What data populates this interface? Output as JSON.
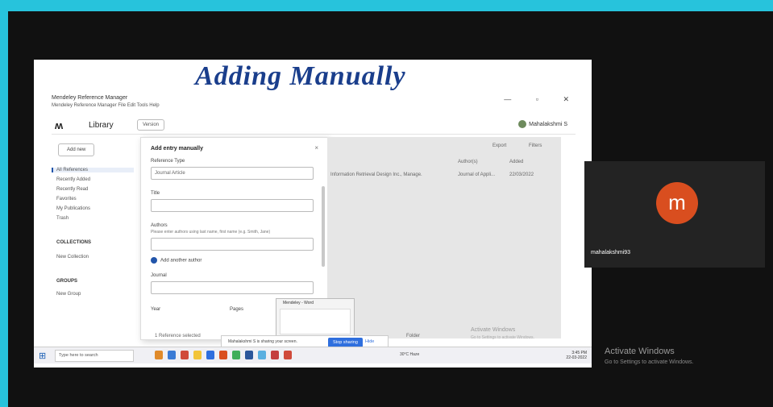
{
  "slide": {
    "title": "Adding Manually"
  },
  "window": {
    "title": "Mendeley Reference Manager",
    "menu": "Mendeley Reference Manager  File  Edit  Tools  Help",
    "controls": "— ▫ ✕"
  },
  "toolbar": {
    "logo": "ʍ",
    "library": "Library",
    "version": "Version",
    "account": "Mahalakshmi S"
  },
  "sidebar": {
    "add_new": "Add new",
    "items": [
      {
        "label": "All References"
      },
      {
        "label": "Recently Added"
      },
      {
        "label": "Recently Read"
      },
      {
        "label": "Favorites"
      },
      {
        "label": "My Publications"
      },
      {
        "label": "Trash"
      }
    ],
    "collections": "COLLECTIONS",
    "new_collection": "New Collection",
    "groups": "GROUPS",
    "new_group": "New Group"
  },
  "dialog": {
    "title": "Add entry manually",
    "close": "×",
    "reference_type_label": "Reference Type",
    "reference_type_value": "Journal Article",
    "title_label": "Title",
    "authors_label": "Authors",
    "authors_hint": "Please enter authors using last name, first name (e.g. Smith, Jane)",
    "add_author": "Add another author",
    "journal_label": "Journal",
    "year_label": "Year",
    "pages_label": "Pages"
  },
  "library": {
    "export": "Export",
    "filters": "Filters",
    "col_authors": "Author(s)",
    "col_added": "Added",
    "row_text": "Information Retrieval Design Inc., Manage.",
    "row_author": "Journal of Appli...",
    "row_date": "22/03/2022"
  },
  "status": {
    "count": "1 Reference selected",
    "folder": "Folder"
  },
  "share": {
    "text": "Mahalakshmi S is sharing your screen.",
    "stop": "Stop sharing",
    "hide": "Hide"
  },
  "thumb": {
    "title": "Mendeley - Word"
  },
  "watermark_small": {
    "line1": "Activate Windows",
    "line2": "Go to Settings to activate Windows."
  },
  "taskbar": {
    "search": "Type here to search",
    "tray": "30°C Haze",
    "clock": "3:45 PM\n22-03-2022"
  },
  "participant": {
    "initial": "m",
    "name": "mahalakshmi93"
  },
  "watermark": {
    "line1": "Activate Windows",
    "line2": "Go to Settings to activate Windows."
  },
  "colors": {
    "accent": "#2f6fde",
    "avatar": "#d94e1f",
    "border": "#27c3dc",
    "title": "#1a3e8c"
  }
}
